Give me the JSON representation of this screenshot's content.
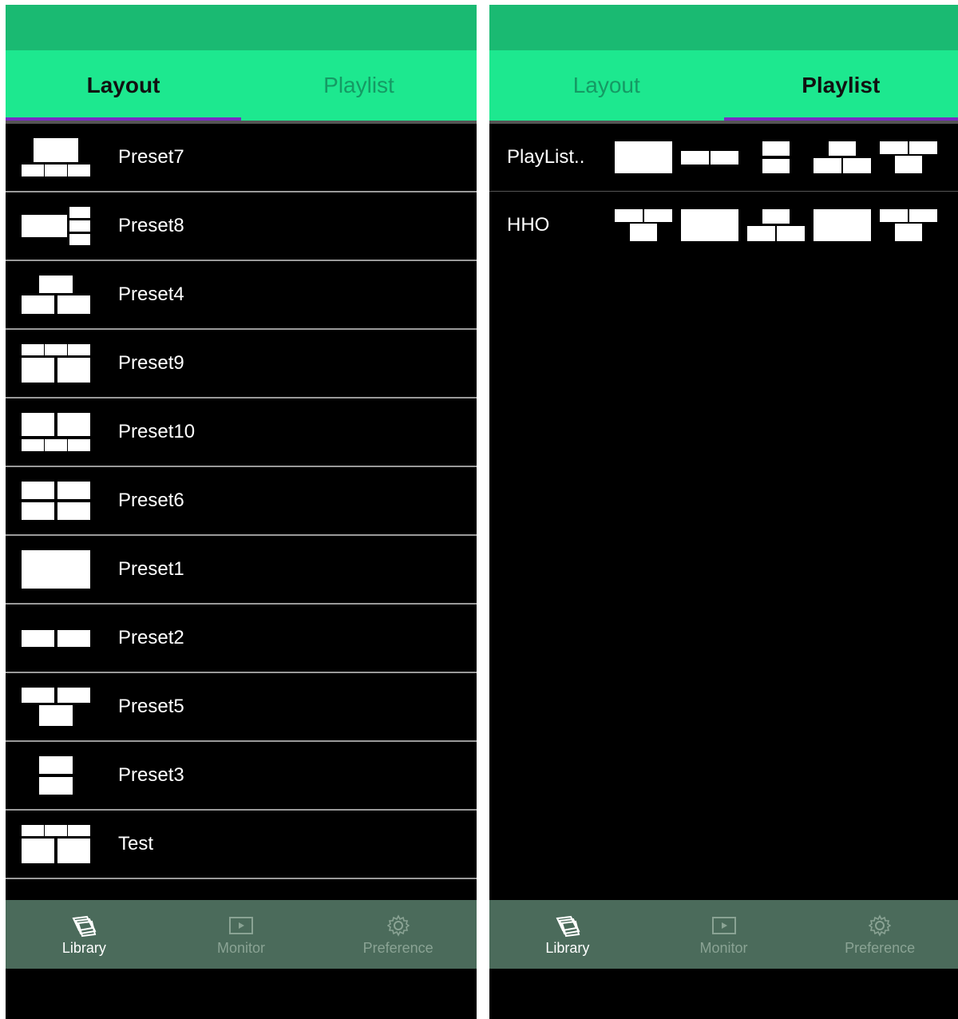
{
  "left": {
    "tabs": [
      {
        "label": "Layout",
        "active": true
      },
      {
        "label": "Playlist",
        "active": false
      }
    ],
    "presets": [
      {
        "name": "Preset7",
        "icon": "layout-1-top-3-bottom"
      },
      {
        "name": "Preset8",
        "icon": "layout-1-left-3-right"
      },
      {
        "name": "Preset4",
        "icon": "layout-1-top-2-bottom"
      },
      {
        "name": "Preset9",
        "icon": "layout-3-top-2-bottom"
      },
      {
        "name": "Preset10",
        "icon": "layout-2-top-3-bottom"
      },
      {
        "name": "Preset6",
        "icon": "layout-2x2"
      },
      {
        "name": "Preset1",
        "icon": "layout-single"
      },
      {
        "name": "Preset2",
        "icon": "layout-2-side"
      },
      {
        "name": "Preset5",
        "icon": "layout-2-top-1-bottom"
      },
      {
        "name": "Preset3",
        "icon": "layout-2-stacked"
      },
      {
        "name": "Test",
        "icon": "layout-3-top-2-bottom"
      },
      {
        "name": "",
        "icon": "layout-3-top-partial"
      }
    ]
  },
  "right": {
    "tabs": [
      {
        "label": "Layout",
        "active": false
      },
      {
        "label": "Playlist",
        "active": true
      }
    ],
    "playlists": [
      {
        "name": "PlayList..",
        "icons": [
          "layout-single",
          "layout-2-side",
          "layout-2-stacked",
          "layout-1-top-2-bottom",
          "layout-2-top-1-bottom"
        ]
      },
      {
        "name": "HHO",
        "icons": [
          "layout-2-top-1-bottom",
          "layout-single",
          "layout-1-top-2-bottom",
          "layout-single",
          "layout-2-top-1-bottom"
        ]
      }
    ]
  },
  "nav": [
    {
      "label": "Library",
      "icon": "library-icon",
      "active": true
    },
    {
      "label": "Monitor",
      "icon": "monitor-icon",
      "active": false
    },
    {
      "label": "Preference",
      "icon": "gear-icon",
      "active": false
    }
  ],
  "colors": {
    "statusbar": "#1aba72",
    "tabbar": "#1de88f",
    "tab_indicator": "#7a2bc4",
    "navbar": "#4b6b5b",
    "background": "#000000"
  }
}
